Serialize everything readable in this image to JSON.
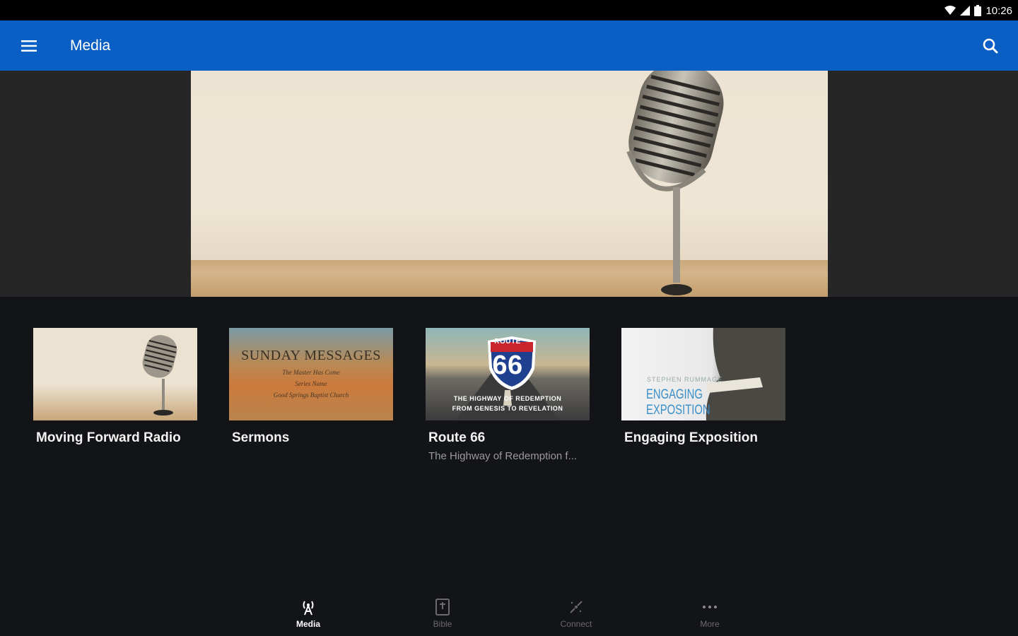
{
  "status_bar": {
    "time": "10:26"
  },
  "app_bar": {
    "title": "Media"
  },
  "media_items": [
    {
      "title": "Moving Forward Radio",
      "subtitle": ""
    },
    {
      "title": "Sermons",
      "subtitle": ""
    },
    {
      "title": "Route 66",
      "subtitle": "The Highway of Redemption f..."
    },
    {
      "title": "Engaging Exposition",
      "subtitle": ""
    }
  ],
  "thumb_text": {
    "sermons": {
      "title": "SUNDAY MESSAGES",
      "line1": "The Master Has Come",
      "line2": "Series Name",
      "line3": "Good Springs Baptist Church"
    },
    "route66": {
      "route": "ROUTE",
      "number": "66",
      "caption1": "THE HIGHWAY OF REDEMPTION",
      "caption2": "FROM GENESIS TO REVELATION"
    },
    "exposition": {
      "author": "STEPHEN RUMMAGE",
      "title": "ENGAGING EXPOSITION"
    }
  },
  "bottom_nav": [
    {
      "label": "Media",
      "icon": "radio-tower-icon",
      "active": true
    },
    {
      "label": "Bible",
      "icon": "bible-icon",
      "active": false
    },
    {
      "label": "Connect",
      "icon": "connect-icon",
      "active": false
    },
    {
      "label": "More",
      "icon": "more-icon",
      "active": false
    }
  ],
  "colors": {
    "app_bar": "#0a5fc4",
    "background": "#121417",
    "hero_band": "#262626",
    "nav_active": "#ffffff",
    "nav_inactive": "#6b6b6b"
  }
}
